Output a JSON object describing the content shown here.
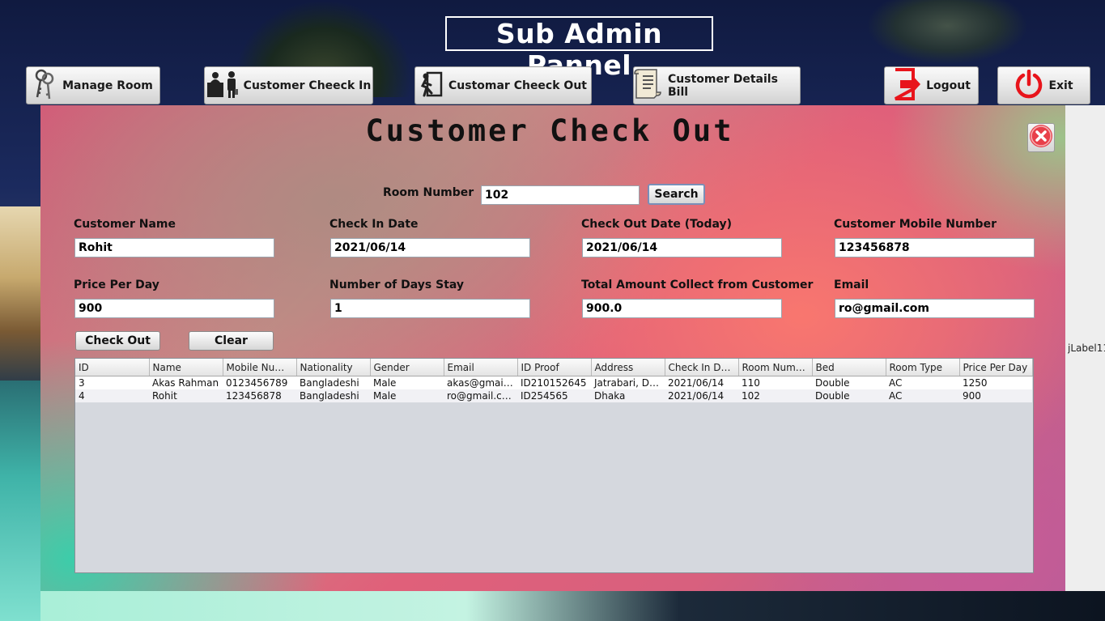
{
  "app": {
    "title": "Sub Admin Pannel"
  },
  "nav": {
    "manage_room": "Manage Room",
    "customer_check_in": "Customer Cheeck In",
    "customer_check_out": "Customar Cheeck Out",
    "customer_details_bill": "Customer Details Bill",
    "logout": "Logout",
    "exit": "Exit"
  },
  "panel": {
    "title": "Customer Check Out",
    "room_number_label": "Room Number",
    "room_number_value": "102",
    "search_button": "Search",
    "fields": {
      "customer_name": {
        "label": "Customer Name",
        "value": "Rohit"
      },
      "check_in_date": {
        "label": "Check In Date",
        "value": "2021/06/14"
      },
      "check_out_date": {
        "label": "Check Out Date (Today)",
        "value": "2021/06/14"
      },
      "customer_mobile": {
        "label": "Customer Mobile Number",
        "value": "123456878"
      },
      "price_per_day": {
        "label": "Price Per Day",
        "value": "900"
      },
      "days_stay": {
        "label": "Number of Days Stay",
        "value": "1"
      },
      "total_amount": {
        "label": "Total Amount Collect from Customer",
        "value": "900.0"
      },
      "email": {
        "label": "Email",
        "value": "ro@gmail.com"
      }
    },
    "check_out_button": "Check Out",
    "clear_button": "Clear"
  },
  "table": {
    "columns": [
      "ID",
      "Name",
      "Mobile Num...",
      "Nationality",
      "Gender",
      "Email",
      "ID Proof",
      "Address",
      "Check In Date",
      "Room Numb...",
      "Bed",
      "Room Type",
      "Price Per Day"
    ],
    "rows": [
      [
        "3",
        "Akas Rahman",
        "0123456789",
        "Bangladeshi",
        "Male",
        "akas@gmail....",
        "ID210152645",
        "Jatrabari, Dh...",
        "2021/06/14",
        "110",
        "Double",
        "AC",
        "1250"
      ],
      [
        "4",
        "Rohit",
        "123456878",
        "Bangladeshi",
        "Male",
        "ro@gmail.com",
        "ID254565",
        "Dhaka",
        "2021/06/14",
        "102",
        "Double",
        "AC",
        "900"
      ]
    ]
  },
  "side_label": "jLabel11",
  "icons": {
    "manage_room": "keys-icon",
    "check_in": "reception-icon",
    "check_out": "exit-door-icon",
    "bill": "receipt-icon",
    "logout": "logout-arrow-icon",
    "exit": "power-icon",
    "close": "close-circle-icon"
  },
  "colors": {
    "logout_red": "#e8141b",
    "close_red": "#e8404a"
  }
}
